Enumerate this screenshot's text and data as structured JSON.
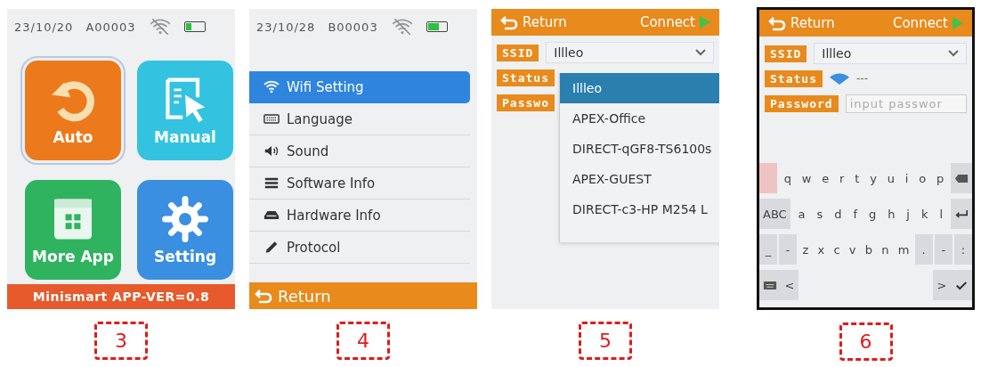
{
  "screens": [
    {
      "kind": "home",
      "number": "3",
      "status": {
        "date": "23/10/20",
        "code": "A00003",
        "level": 0.3
      },
      "tiles": [
        {
          "label": "Auto",
          "color": "#ec7a1c",
          "kind": "refresh",
          "selected": true
        },
        {
          "label": "Manual",
          "color": "#33c3e0",
          "kind": "cursor",
          "selected": false
        },
        {
          "label": "More App",
          "color": "#2fb35f",
          "kind": "grid",
          "selected": false
        },
        {
          "label": "Setting",
          "color": "#3a8fe0",
          "kind": "gear",
          "selected": false
        }
      ],
      "footer": "Minismart APP-VER=0.8"
    },
    {
      "kind": "menu",
      "number": "4",
      "status": {
        "date": "23/10/28",
        "code": "B00003",
        "level": 0.6
      },
      "items": [
        {
          "label": "Wifi Setting",
          "kind": "wifi",
          "selected": true
        },
        {
          "label": "Language",
          "kind": "keyboard",
          "selected": false
        },
        {
          "label": "Sound",
          "kind": "speaker",
          "selected": false
        },
        {
          "label": "Software Info",
          "kind": "list",
          "selected": false
        },
        {
          "label": "Hardware Info",
          "kind": "tray",
          "selected": false
        },
        {
          "label": "Protocol",
          "kind": "pencil",
          "selected": false
        }
      ],
      "footer": "Return"
    },
    {
      "kind": "wifi",
      "number": "5",
      "back": "Return",
      "connect": "Connect",
      "fields": [
        {
          "label": "SSID",
          "kind": "select",
          "value": "Illleo"
        },
        {
          "label": "Status",
          "kind": "blank"
        },
        {
          "label": "Passwo",
          "kind": "blank"
        }
      ],
      "options": [
        {
          "label": "Illleo",
          "selected": true
        },
        {
          "label": "APEX-Office",
          "selected": false
        },
        {
          "label": "DIRECT-qGF8-TS6100s",
          "selected": false
        },
        {
          "label": "APEX-GUEST",
          "selected": false
        },
        {
          "label": "DIRECT-c3-HP M254 L",
          "selected": false
        }
      ]
    },
    {
      "kind": "wifi",
      "number": "6",
      "back": "Return",
      "connect": "Connect",
      "fields": [
        {
          "label": "SSID",
          "kind": "select",
          "value": "Illleo"
        },
        {
          "label": "Status",
          "kind": "status",
          "value": "---"
        },
        {
          "label": "Password",
          "kind": "input",
          "placeholder": "input passwor"
        }
      ],
      "keyboard": [
        [
          {
            "kind": "symbol"
          },
          {
            "kind": "letter",
            "label": "q"
          },
          {
            "kind": "letter",
            "label": "w"
          },
          {
            "kind": "letter",
            "label": "e"
          },
          {
            "kind": "letter",
            "label": "r"
          },
          {
            "kind": "letter",
            "label": "t"
          },
          {
            "kind": "letter",
            "label": "y"
          },
          {
            "kind": "letter",
            "label": "u"
          },
          {
            "kind": "letter",
            "label": "i"
          },
          {
            "kind": "letter",
            "label": "o"
          },
          {
            "kind": "letter",
            "label": "p"
          },
          {
            "kind": "backspace"
          }
        ],
        [
          {
            "kind": "func",
            "label": "ABC"
          },
          {
            "kind": "letter",
            "label": "a"
          },
          {
            "kind": "letter",
            "label": "s"
          },
          {
            "kind": "letter",
            "label": "d"
          },
          {
            "kind": "letter",
            "label": "f"
          },
          {
            "kind": "letter",
            "label": "g"
          },
          {
            "kind": "letter",
            "label": "h"
          },
          {
            "kind": "letter",
            "label": "j"
          },
          {
            "kind": "letter",
            "label": "k"
          },
          {
            "kind": "letter",
            "label": "l"
          },
          {
            "kind": "enter"
          }
        ],
        [
          {
            "kind": "func",
            "label": "_"
          },
          {
            "kind": "func",
            "label": "-"
          },
          {
            "kind": "letter",
            "label": "z"
          },
          {
            "kind": "letter",
            "label": "x"
          },
          {
            "kind": "letter",
            "label": "c"
          },
          {
            "kind": "letter",
            "label": "v"
          },
          {
            "kind": "letter",
            "label": "b"
          },
          {
            "kind": "letter",
            "label": "n"
          },
          {
            "kind": "letter",
            "label": "m"
          },
          {
            "kind": "func",
            "label": "."
          },
          {
            "kind": "func",
            "label": "-"
          },
          {
            "kind": "func",
            "label": ":"
          }
        ],
        [
          {
            "kind": "keyboard"
          },
          {
            "kind": "func",
            "label": "<"
          },
          {
            "kind": "space"
          },
          {
            "kind": "func",
            "label": ">"
          },
          {
            "kind": "check"
          }
        ]
      ]
    }
  ]
}
